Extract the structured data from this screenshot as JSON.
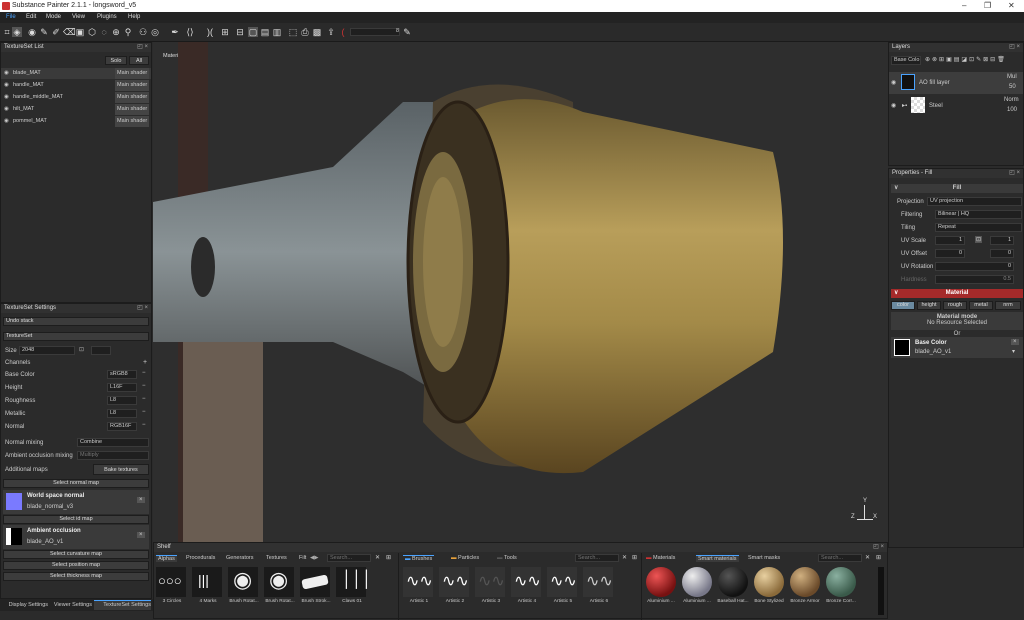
{
  "window": {
    "title": "Substance Painter 2.1.1 - longsword_v5",
    "controls": [
      "–",
      "❐",
      "✕"
    ]
  },
  "menu": [
    "File",
    "Edit",
    "Mode",
    "View",
    "Plugins",
    "Help"
  ],
  "toolbar": {
    "brush_size": "8"
  },
  "textureset_list": {
    "title": "TextureSet List",
    "solo": "Solo",
    "all": "All",
    "items": [
      {
        "name": "blade_MAT",
        "shader": "Main shader"
      },
      {
        "name": "handle_MAT",
        "shader": "Main shader"
      },
      {
        "name": "handle_middle_MAT",
        "shader": "Main shader"
      },
      {
        "name": "hilt_MAT",
        "shader": "Main shader"
      },
      {
        "name": "pommel_MAT",
        "shader": "Main shader"
      }
    ]
  },
  "textureset_settings": {
    "title": "TextureSet Settings",
    "undo_stack": "Undo stack",
    "textureset": "TextureSet",
    "size_label": "Size",
    "size_value": "2048",
    "channels_label": "Channels",
    "channels": [
      {
        "name": "Base Color",
        "format": "sRGB8"
      },
      {
        "name": "Height",
        "format": "L16F"
      },
      {
        "name": "Roughness",
        "format": "L8"
      },
      {
        "name": "Metallic",
        "format": "L8"
      },
      {
        "name": "Normal",
        "format": "RGB16F"
      }
    ],
    "normal_mixing_label": "Normal mixing",
    "normal_mixing_value": "Combine",
    "ao_mixing_label": "Ambient occlusion mixing",
    "ao_mixing_value": "Multiply",
    "additional_maps": "Additional maps",
    "bake_textures": "Bake textures",
    "select_normal_map": "Select normal map",
    "world_space_normal": {
      "title": "World space normal",
      "file": "blade_normal_v3"
    },
    "select_id_map": "Select id map",
    "ambient_occlusion": {
      "title": "Ambient occlusion",
      "file": "blade_AO_v1"
    },
    "select_curvature_map": "Select curvature map",
    "select_position_map": "Select position map",
    "select_thickness_map": "Select thickness map"
  },
  "bottom_tabs": [
    "Display Settings",
    "Viewer Settings",
    "TextureSet Settings"
  ],
  "viewport": {
    "label": "Material",
    "axis": {
      "y": "Y",
      "z": "Z",
      "x": "X"
    }
  },
  "layers": {
    "title": "Layers",
    "channel": "Base Colo",
    "items": [
      {
        "name": "AO fill layer",
        "blend": "Mul",
        "opacity": "50"
      },
      {
        "name": "Steel",
        "blend": "Norm",
        "opacity": "100"
      }
    ]
  },
  "properties": {
    "title": "Properties - Fill",
    "fill": "Fill",
    "projection_label": "Projection",
    "projection_value": "UV projection",
    "filtering_label": "Filtering",
    "filtering_value": "Bilinear | HQ",
    "tiling_label": "Tiling",
    "tiling_value": "Repeat",
    "uv_scale_label": "UV Scale",
    "uv_scale_value": "1",
    "uv_scale_value2": "1",
    "uv_offset_label": "UV Offset",
    "uv_offset_value": "0",
    "uv_offset_value2": "0",
    "uv_rotation_label": "UV Rotation",
    "uv_rotation_value": "0",
    "hardness_label": "Hardness",
    "hardness_value": "0.5",
    "material": "Material",
    "channel_buttons": [
      "color",
      "height",
      "rough",
      "metal",
      "nrm"
    ],
    "material_mode": "Material mode",
    "no_resource": "No Resource Selected",
    "or": "Or",
    "base_color": {
      "title": "Base Color",
      "file": "blade_AO_v1"
    }
  },
  "shelf": {
    "title": "Shelf",
    "tabs": [
      "Alphas",
      "Procedurals",
      "Generators",
      "Textures",
      "Filt"
    ],
    "search": "Search...",
    "alphas": [
      "3 Circles",
      "4 Marks",
      "Brush Rotat...",
      "Brush Rotat...",
      "Brush Strok...",
      "Claws 01"
    ],
    "brush_tabs": [
      "Brushes",
      "Particles",
      "Tools"
    ],
    "brushes": [
      "Artistic 1",
      "Artistic 2",
      "Artistic 3",
      "Artistic 4",
      "Artistic 5",
      "Artistic 6"
    ],
    "material_tabs": [
      "Materials",
      "Smart materials",
      "Smart masks"
    ],
    "materials": [
      "Aluminium ...",
      "Aluminium ...",
      "Baseball Hat...",
      "Bone Stylized",
      "Bronze Armor",
      "Bronze Corr..."
    ]
  },
  "colors": {
    "accent": "#4aa3ff",
    "material_red": "#a52a2a"
  }
}
